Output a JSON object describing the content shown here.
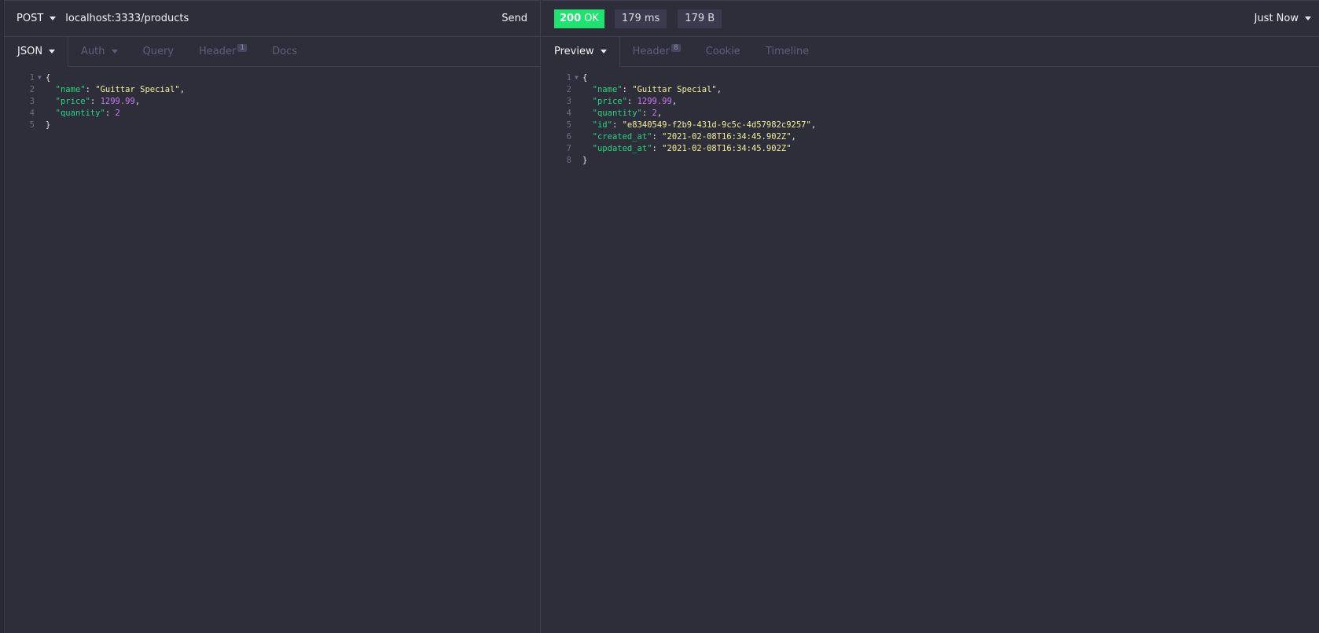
{
  "request": {
    "method": "POST",
    "url": "localhost:3333/products",
    "send_label": "Send",
    "tabs": [
      {
        "label": "JSON"
      },
      {
        "label": "Auth"
      },
      {
        "label": "Query"
      },
      {
        "label": "Header",
        "count": "1"
      },
      {
        "label": "Docs"
      }
    ],
    "body_lines": [
      {
        "n": "1",
        "text": "{"
      },
      {
        "n": "2",
        "key": "\"name\"",
        "sep": ": ",
        "val": "\"Guittar Special\"",
        "vtype": "s",
        "end": ","
      },
      {
        "n": "3",
        "key": "\"price\"",
        "sep": ": ",
        "val": "1299.99",
        "vtype": "n",
        "end": ","
      },
      {
        "n": "4",
        "key": "\"quantity\"",
        "sep": ": ",
        "val": "2",
        "vtype": "n",
        "end": ""
      },
      {
        "n": "5",
        "text": "}"
      }
    ]
  },
  "response": {
    "status_code": "200",
    "status_text": "OK",
    "time": "179 ms",
    "size": "179 B",
    "history_label": "Just Now",
    "tabs": [
      {
        "label": "Preview"
      },
      {
        "label": "Header",
        "count": "8"
      },
      {
        "label": "Cookie"
      },
      {
        "label": "Timeline"
      }
    ],
    "body_lines": [
      {
        "n": "1",
        "text": "{"
      },
      {
        "n": "2",
        "key": "\"name\"",
        "sep": ": ",
        "val": "\"Guittar Special\"",
        "vtype": "s",
        "end": ","
      },
      {
        "n": "3",
        "key": "\"price\"",
        "sep": ": ",
        "val": "1299.99",
        "vtype": "n",
        "end": ","
      },
      {
        "n": "4",
        "key": "\"quantity\"",
        "sep": ": ",
        "val": "2",
        "vtype": "n",
        "end": ","
      },
      {
        "n": "5",
        "key": "\"id\"",
        "sep": ": ",
        "val": "\"e8340549-f2b9-431d-9c5c-4d57982c9257\"",
        "vtype": "s",
        "end": ","
      },
      {
        "n": "6",
        "key": "\"created_at\"",
        "sep": ": ",
        "val": "\"2021-02-08T16:34:45.902Z\"",
        "vtype": "s",
        "end": ","
      },
      {
        "n": "7",
        "key": "\"updated_at\"",
        "sep": ": ",
        "val": "\"2021-02-08T16:34:45.902Z\"",
        "vtype": "s",
        "end": ""
      },
      {
        "n": "8",
        "text": "}"
      }
    ]
  },
  "colors": {
    "background": "#2e2e3b",
    "status_ok": "#1ee36f",
    "json_key": "#27d57c",
    "json_string": "#f3f099",
    "json_number": "#c77df0"
  }
}
